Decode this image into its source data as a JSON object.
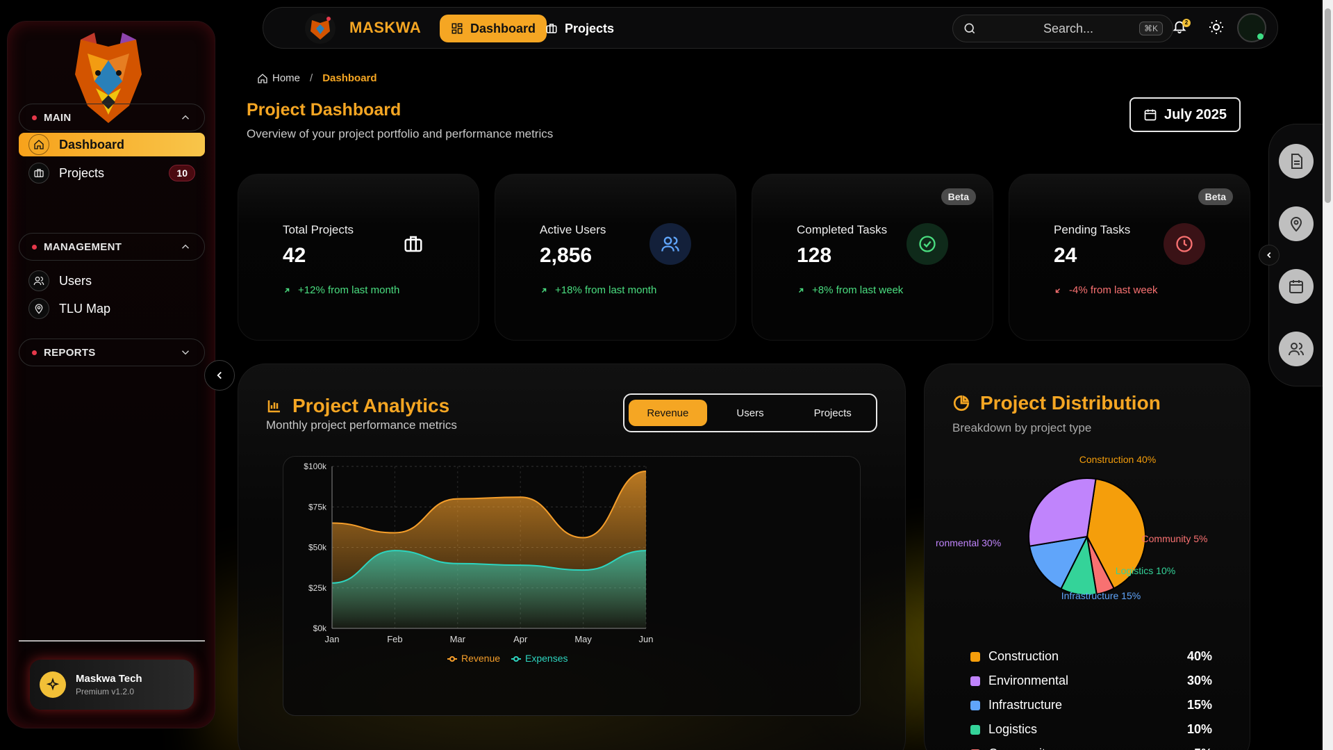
{
  "brand": {
    "name": "MASKWA"
  },
  "topbar": {
    "tabs": [
      {
        "label": "Dashboard"
      },
      {
        "label": "Projects"
      }
    ],
    "search_placeholder": "Search...",
    "shortcut": "⌘K",
    "notif_count": "2"
  },
  "sidebar": {
    "sections": [
      {
        "label": "MAIN",
        "items": [
          {
            "label": "Dashboard",
            "icon": "home-icon"
          },
          {
            "label": "Projects",
            "icon": "briefcase-icon",
            "badge": "10"
          }
        ]
      },
      {
        "label": "MANAGEMENT",
        "items": [
          {
            "label": "Users",
            "icon": "users-icon"
          },
          {
            "label": "TLU Map",
            "icon": "map-pin-icon"
          }
        ]
      },
      {
        "label": "REPORTS",
        "items": []
      }
    ],
    "profile": {
      "name": "Maskwa Tech",
      "plan": "Premium v1.2.0"
    }
  },
  "breadcrumb": {
    "home": "Home",
    "current": "Dashboard"
  },
  "header": {
    "title": "Project Dashboard",
    "subtitle": "Overview of your project portfolio and performance metrics",
    "date": "July 2025"
  },
  "stats": [
    {
      "label": "Total Projects",
      "value": "42",
      "change": "+12% from last month",
      "trend": "up",
      "beta": ""
    },
    {
      "label": "Active Users",
      "value": "2,856",
      "change": "+18% from last month",
      "trend": "up",
      "beta": ""
    },
    {
      "label": "Completed Tasks",
      "value": "128",
      "change": "+8% from last week",
      "trend": "up",
      "beta": "Beta"
    },
    {
      "label": "Pending Tasks",
      "value": "24",
      "change": "-4% from last week",
      "trend": "down",
      "beta": "Beta"
    }
  ],
  "analytics": {
    "title": "Project Analytics",
    "subtitle": "Monthly project performance metrics",
    "tabs": [
      "Revenue",
      "Users",
      "Projects"
    ],
    "active_tab": "Revenue"
  },
  "chart_data": {
    "type": "area",
    "x": [
      "Jan",
      "Feb",
      "Mar",
      "Apr",
      "May",
      "Jun"
    ],
    "series": [
      {
        "name": "Revenue",
        "values": [
          65000,
          59000,
          80000,
          81000,
          56000,
          97000
        ],
        "color": "#f59e2a"
      },
      {
        "name": "Expenses",
        "values": [
          28000,
          48000,
          40000,
          39000,
          36000,
          48000
        ],
        "color": "#2dd4bf"
      }
    ],
    "yticks": [
      "$0k",
      "$25k",
      "$50k",
      "$75k",
      "$100k"
    ],
    "ylim": [
      0,
      100000
    ],
    "grid": true,
    "legend": "bottom"
  },
  "distribution": {
    "title": "Project Distribution",
    "subtitle": "Breakdown by project type",
    "pie_labels": [
      "Construction 40%",
      "ronmental 30%",
      "Community 5%",
      "Logistics 10%",
      "Infrastructure 15%"
    ],
    "items": [
      {
        "label": "Construction",
        "value": 40,
        "pct": "40%",
        "color": "#f59e0b"
      },
      {
        "label": "Environmental",
        "value": 30,
        "pct": "30%",
        "color": "#c084fc"
      },
      {
        "label": "Infrastructure",
        "value": 15,
        "pct": "15%",
        "color": "#60a5fa"
      },
      {
        "label": "Logistics",
        "value": 10,
        "pct": "10%",
        "color": "#34d399"
      },
      {
        "label": "Community",
        "value": 5,
        "pct": "5%",
        "color": "#f87171"
      }
    ]
  },
  "rail": {
    "items": [
      "document-icon",
      "map-pin-icon",
      "calendar-icon",
      "users-icon"
    ]
  }
}
